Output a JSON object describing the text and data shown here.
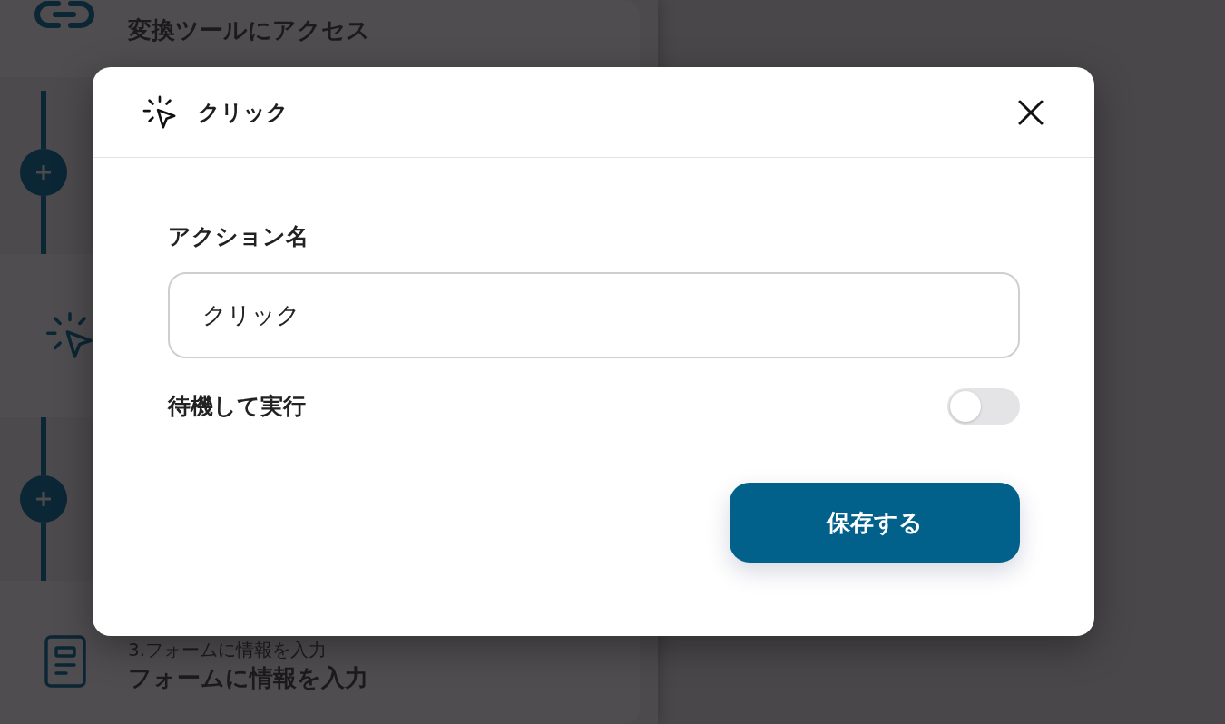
{
  "steps": [
    {
      "kind": "link",
      "title": "変換ツールにアクセス"
    },
    {
      "kind": "click"
    },
    {
      "kind": "form",
      "subtitle": "3.フォームに情報を入力",
      "title": "フォームに情報を入力"
    }
  ],
  "modal": {
    "title": "クリック",
    "fields": [
      {
        "kind": "text",
        "label": "アクション名",
        "value": "クリック"
      },
      {
        "kind": "toggle",
        "label": "待機して実行",
        "on": false
      }
    ],
    "save_button": "保存する"
  }
}
